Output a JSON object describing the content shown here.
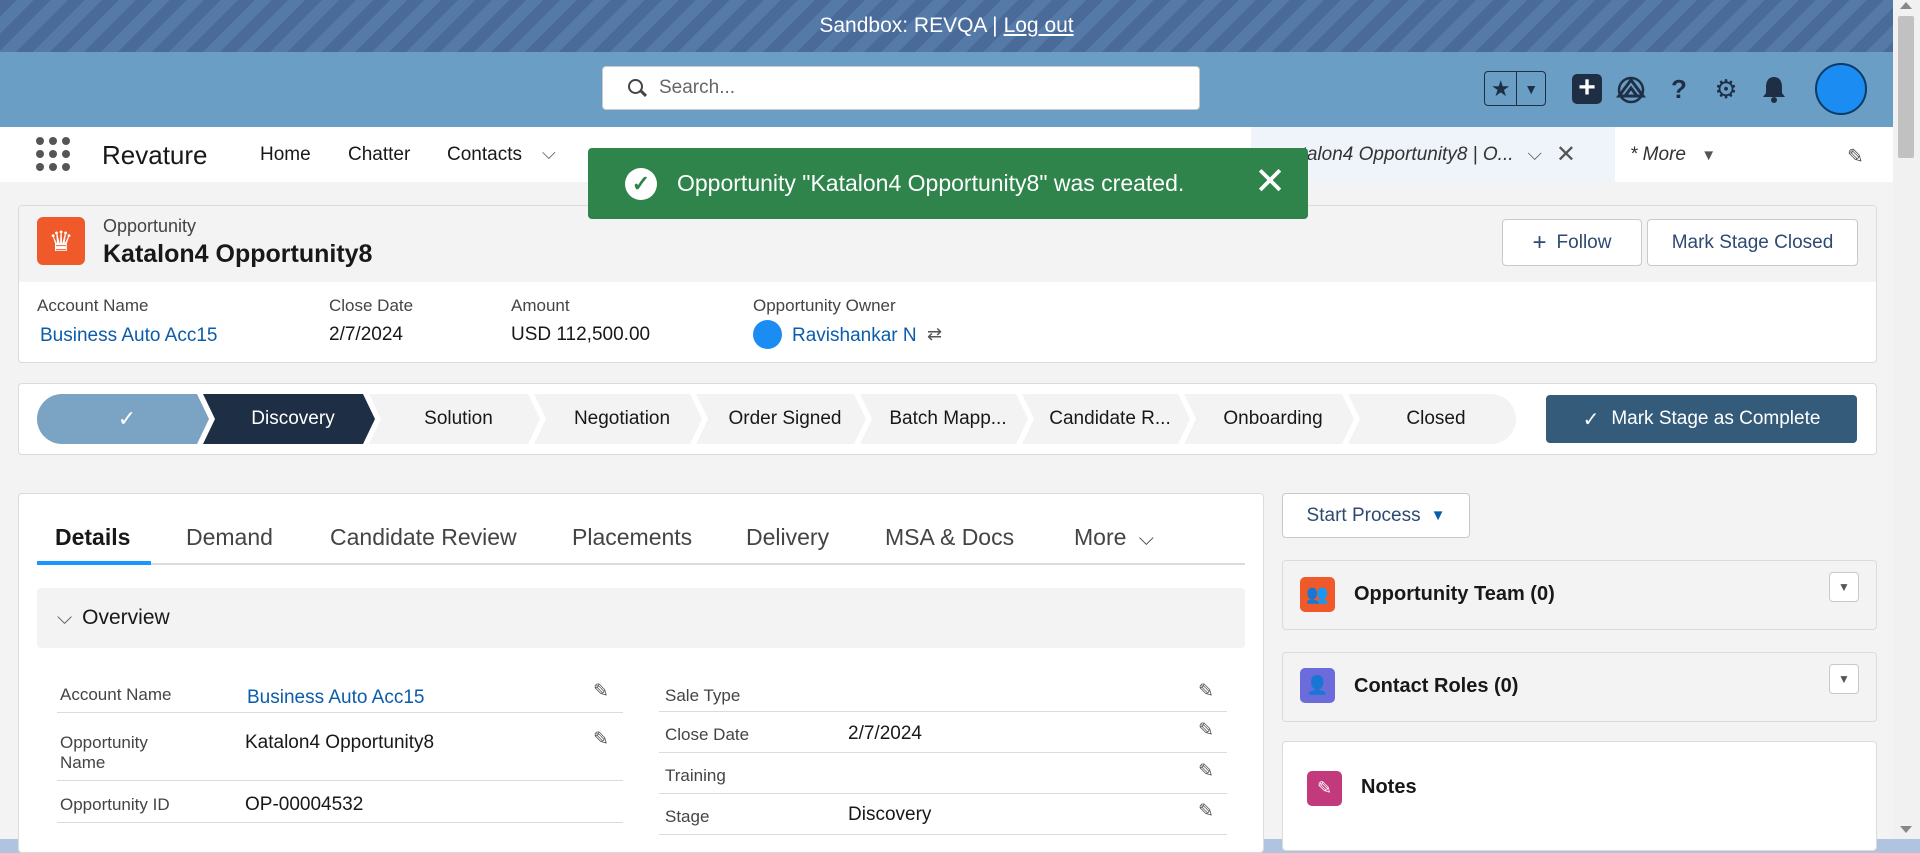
{
  "sandbox": {
    "label": "Sandbox: REVQA |",
    "logout": "Log out"
  },
  "search": {
    "placeholder": "Search..."
  },
  "app": {
    "name": "Revature",
    "nav": [
      "Home",
      "Chatter",
      "Contacts"
    ],
    "active_tab": "atalon4 Opportunity8 | O...",
    "more": "* More"
  },
  "toast": {
    "message": "Opportunity \"Katalon4 Opportunity8\" was created."
  },
  "record": {
    "type": "Opportunity",
    "title": "Katalon4 Opportunity8",
    "follow": "Follow",
    "mark_closed": "Mark Stage Closed",
    "highlights": {
      "account_name_label": "Account Name",
      "account_name": "Business Auto Acc15",
      "close_date_label": "Close Date",
      "close_date": "2/7/2024",
      "amount_label": "Amount",
      "amount": "USD 112,500.00",
      "owner_label": "Opportunity Owner",
      "owner": "Ravishankar N"
    }
  },
  "path": {
    "completed_mark": "✓",
    "steps": [
      "Discovery",
      "Solution",
      "Negotiation",
      "Order Signed",
      "Batch Mapp...",
      "Candidate R...",
      "Onboarding",
      "Closed"
    ],
    "mark_complete": "Mark Stage as Complete"
  },
  "tabs": [
    "Details",
    "Demand",
    "Candidate Review",
    "Placements",
    "Delivery",
    "MSA & Docs",
    "More"
  ],
  "overview": {
    "section_title": "Overview",
    "left": [
      {
        "label": "Account Name",
        "value": "Business Auto Acc15"
      },
      {
        "label": "Opportunity Name",
        "value": "Katalon4 Opportunity8"
      },
      {
        "label": "Opportunity ID",
        "value": "OP-00004532"
      }
    ],
    "right": [
      {
        "label": "Sale Type",
        "value": ""
      },
      {
        "label": "Close Date",
        "value": "2/7/2024"
      },
      {
        "label": "Training",
        "value": ""
      },
      {
        "label": "Stage",
        "value": "Discovery"
      }
    ]
  },
  "sidebar": {
    "start_process": "Start Process",
    "team": "Opportunity Team (0)",
    "roles": "Contact Roles (0)",
    "notes": "Notes"
  },
  "colors": {
    "toast": "#2e844a",
    "path_current": "#1e2f45",
    "brand_blue": "#1b96ff",
    "record_icon": "#f05a2b"
  },
  "icons": [
    "search-icon",
    "star-icon",
    "plus-icon",
    "trailhead-icon",
    "help-icon",
    "gear-icon",
    "bell-icon",
    "waffle-icon",
    "check-icon",
    "close-icon",
    "crown-icon",
    "pencil-icon",
    "team-icon",
    "contact-role-icon",
    "notes-icon"
  ]
}
